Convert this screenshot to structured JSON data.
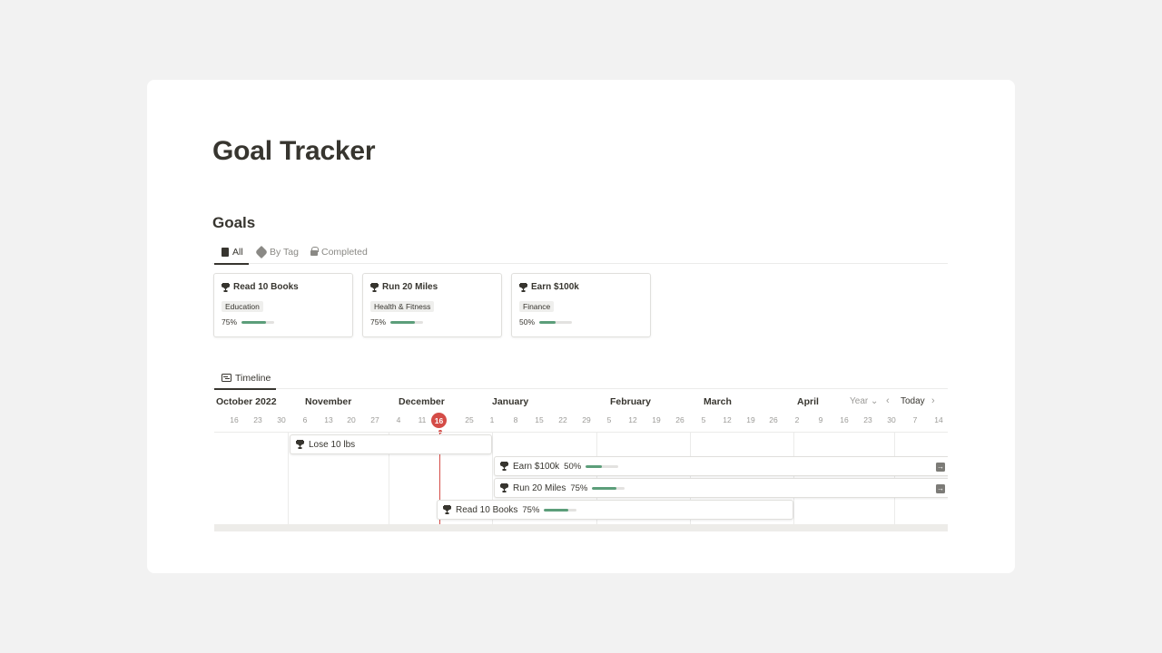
{
  "page": {
    "title": "Goal Tracker"
  },
  "section": {
    "title": "Goals"
  },
  "tabs": [
    {
      "label": "All",
      "icon": "book-icon",
      "active": true
    },
    {
      "label": "By Tag",
      "icon": "tag-icon",
      "active": false
    },
    {
      "label": "Completed",
      "icon": "lock-icon",
      "active": false
    }
  ],
  "gallery": [
    {
      "title": "Read 10 Books",
      "tag": "Education",
      "progress_label": "75%",
      "progress": 0.75
    },
    {
      "title": "Run 20 Miles",
      "tag": "Health & Fitness",
      "progress_label": "75%",
      "progress": 0.75
    },
    {
      "title": "Earn $100k",
      "tag": "Finance",
      "progress_label": "50%",
      "progress": 0.5
    }
  ],
  "timeline": {
    "tab_label": "Timeline",
    "months": [
      "October 2022",
      "November",
      "December",
      "January",
      "February",
      "March",
      "April"
    ],
    "days": [
      "16",
      "23",
      "30",
      "6",
      "13",
      "20",
      "27",
      "4",
      "11",
      "16",
      "25",
      "1",
      "8",
      "15",
      "22",
      "29",
      "5",
      "12",
      "19",
      "26",
      "5",
      "12",
      "19",
      "26",
      "2",
      "9",
      "16",
      "23",
      "30",
      "7",
      "14"
    ],
    "today": "16",
    "controls": {
      "view": "Year ⌄",
      "prev": "‹",
      "today": "Today",
      "next": "›"
    },
    "bars": [
      {
        "name": "Lose 10 lbs",
        "progress_label": "",
        "progress": null,
        "overflow": false
      },
      {
        "name": "Earn $100k",
        "progress_label": "50%",
        "progress": 0.5,
        "overflow": true
      },
      {
        "name": "Run 20 Miles",
        "progress_label": "75%",
        "progress": 0.75,
        "overflow": true
      },
      {
        "name": "Read 10 Books",
        "progress_label": "75%",
        "progress": 0.75,
        "overflow": false
      }
    ]
  },
  "colors": {
    "progress_fill": "#5c9e7a",
    "today_marker": "#d44c47",
    "text": "#37352f"
  }
}
